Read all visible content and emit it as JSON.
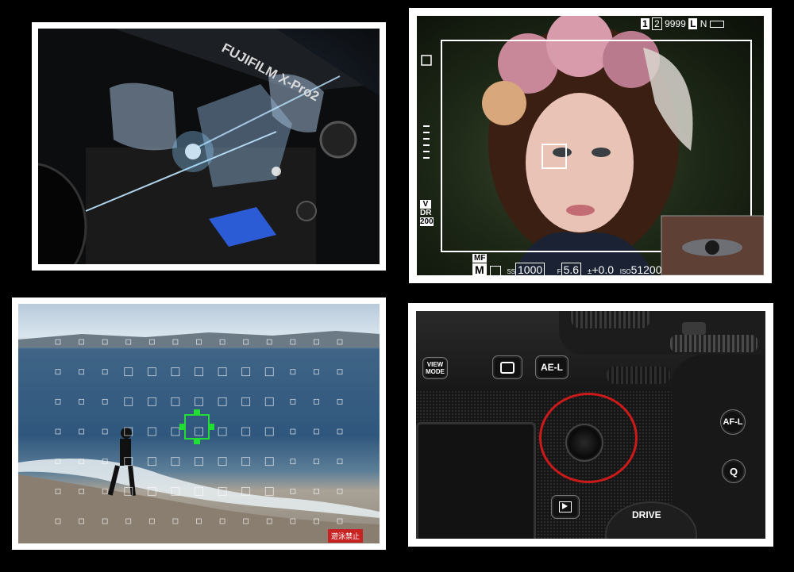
{
  "panels": {
    "viewfinder": {
      "body_text": "FUJIFILM X-Pro2"
    },
    "evf": {
      "frame_counts": "9999",
      "quality_l": "L",
      "quality_n": "N",
      "focus_mode": "MF",
      "exposure_mode": "M",
      "shutter_label": "SS",
      "shutter_value": "1000",
      "aperture_label": "F",
      "aperture_value": "5.6",
      "exp_comp": "+0.0",
      "iso_label": "ISO",
      "iso_value": "51200",
      "film_sim": "V",
      "dynamic_range_label": "DR",
      "dynamic_range_value": "200"
    },
    "beach": {
      "sign_text": "遊泳禁止"
    },
    "camera_back": {
      "view_mode_line1": "VIEW",
      "view_mode_line2": "MODE",
      "ael_label": "AE-L",
      "afl_label": "AF-L",
      "q_label": "Q",
      "drive_label": "DRIVE"
    }
  },
  "colors": {
    "focus_box": "#22dd33",
    "highlight_circle": "#cc1a1a",
    "frame_border": "#ffffff"
  }
}
